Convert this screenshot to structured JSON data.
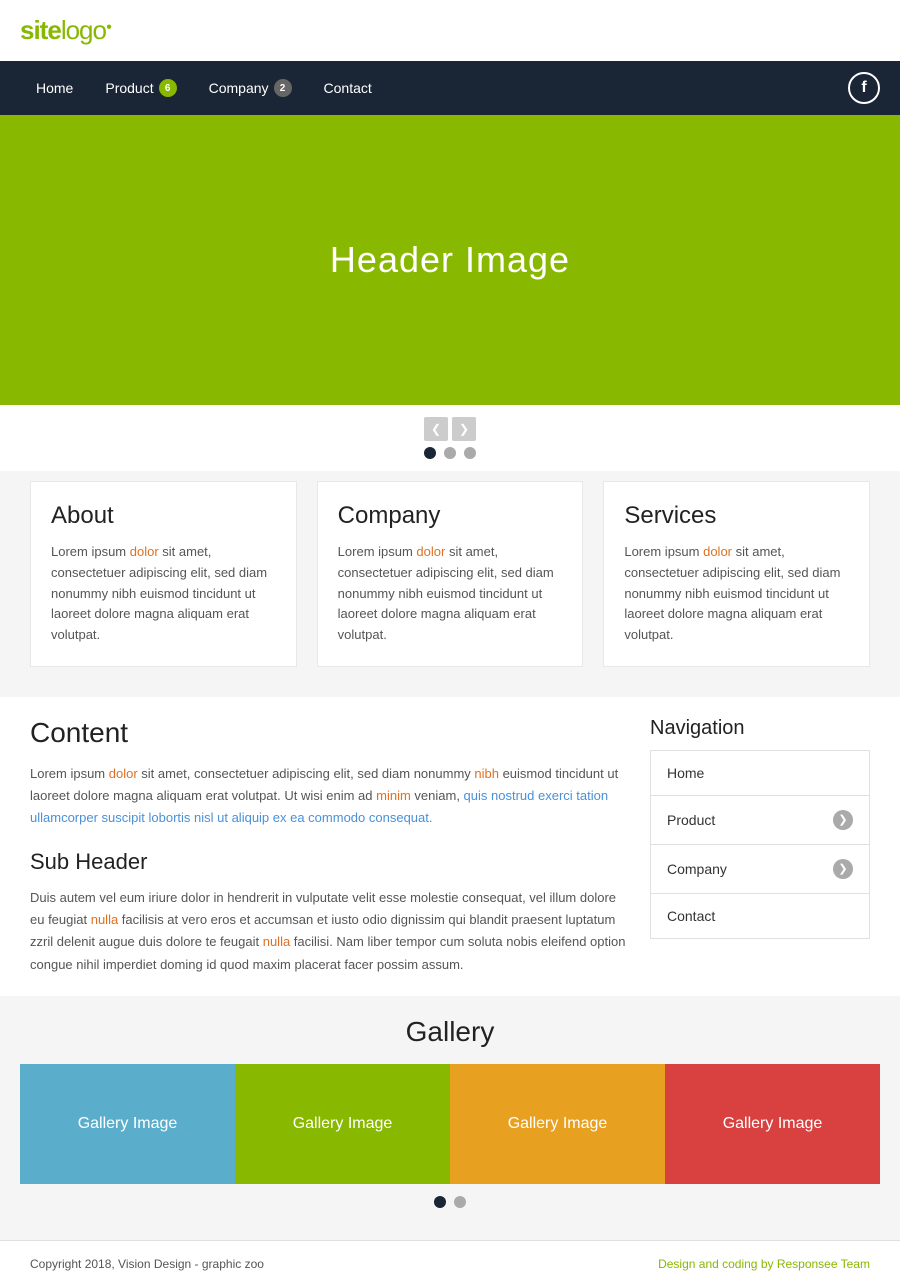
{
  "site": {
    "logo_text": "site",
    "logo_accent": "logo",
    "logo_dot": "●"
  },
  "nav": {
    "items": [
      {
        "label": "Home",
        "badge": null
      },
      {
        "label": "Product",
        "badge": "6",
        "badge_type": "green"
      },
      {
        "label": "Company",
        "badge": "2",
        "badge_type": "gray"
      },
      {
        "label": "Contact",
        "badge": null
      }
    ],
    "fb_label": "f"
  },
  "hero": {
    "text": "Header Image"
  },
  "slider": {
    "prev_arrow": "❮",
    "next_arrow": "❯",
    "dots": [
      true,
      false,
      false
    ]
  },
  "cards": [
    {
      "title": "About",
      "body": "Lorem ipsum dolor sit amet, consectetuer adipiscing elit, sed diam nonummy nibh euismod tincidunt ut laoreet dolore magna aliquam erat volutpat."
    },
    {
      "title": "Company",
      "body": "Lorem ipsum dolor sit amet, consectetuer adipiscing elit, sed diam nonummy nibh euismod tincidunt ut laoreet dolore magna aliquam erat volutpat."
    },
    {
      "title": "Services",
      "body": "Lorem ipsum dolor sit amet, consectetuer adipiscing elit, sed diam nonummy nibh euismod tincidunt ut laoreet dolore magna aliquam erat volutpat."
    }
  ],
  "content": {
    "title": "Content",
    "body1": "Lorem ipsum dolor sit amet, consectetuer adipiscing elit, sed diam nonummy nibh euismod tincidunt ut laoreet dolore magna aliquam erat volutpat. Ut wisi enim ad minim veniam, quis nostrud exerci tation ullamcorper suscipit lobortis nisl ut aliquip ex ea commodo consequat.",
    "subheader": "Sub Header",
    "body2": "Duis autem vel eum iriure dolor in hendrerit in vulputate velit esse molestie consequat, vel illum dolore eu feugiat nulla facilisis at vero eros et accumsan et iusto odio dignissim qui blandit praesent luptatum zzril delenit augue duis dolore te feugait nulla facilisi. Nam liber tempor cum soluta nobis eleifend option congue nihil imperdiet doming id quod mazim placerat facer possim assum."
  },
  "sidebar": {
    "title": "Navigation",
    "items": [
      {
        "label": "Home",
        "arrow": false
      },
      {
        "label": "Product",
        "arrow": true
      },
      {
        "label": "Company",
        "arrow": true
      },
      {
        "label": "Contact",
        "arrow": false
      }
    ]
  },
  "gallery": {
    "title": "Gallery",
    "images": [
      {
        "label": "Gallery Image",
        "color": "#5aaecc"
      },
      {
        "label": "Gallery Image",
        "color": "#88b800"
      },
      {
        "label": "Gallery Image",
        "color": "#e8a020"
      },
      {
        "label": "Gallery Image",
        "color": "#d94040"
      }
    ],
    "dots": [
      true,
      false
    ]
  },
  "footer": {
    "copy": "Copyright 2018, Vision Design - graphic zoo",
    "credit": "Design and coding by Responsee Team"
  }
}
